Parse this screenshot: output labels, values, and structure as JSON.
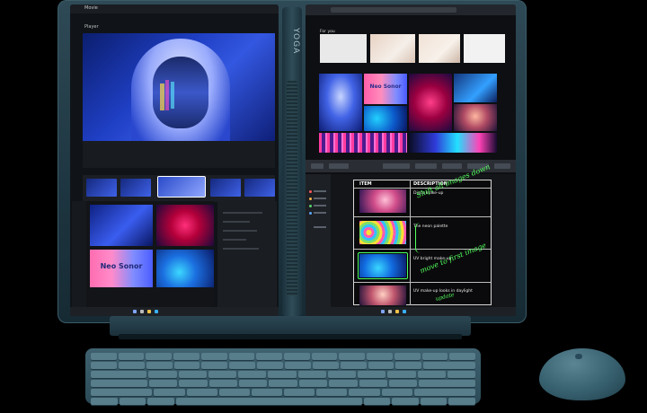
{
  "device": {
    "brand_logo": "YOGA",
    "colors": {
      "body": "#2e4a56",
      "accent_ink": "#53ff5c"
    }
  },
  "left_screen": {
    "app_title": "Movie",
    "panel_label": "Player",
    "tile_text": "Neo Sonor"
  },
  "right_screen": {
    "feed_label": "For you",
    "image_text": "Neo Sonor",
    "document": {
      "headers": {
        "item": "ITEM",
        "description": "DESCRIPTION"
      },
      "rows": [
        {
          "description": "Disco make-up"
        },
        {
          "description": "The neon palette"
        },
        {
          "description": "UV bright make-up"
        },
        {
          "description": "UV make-up looks in daylight"
        }
      ],
      "annotations": [
        "Shift all images down",
        "move to first image",
        "update"
      ]
    }
  }
}
